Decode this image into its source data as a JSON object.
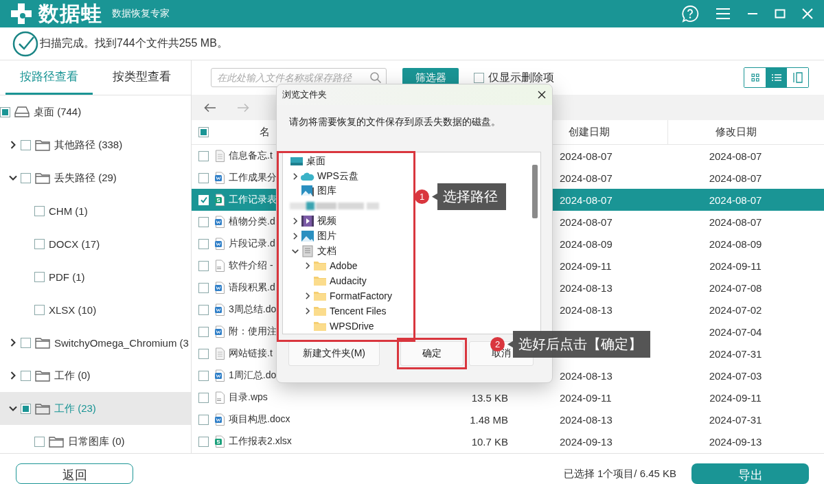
{
  "app": {
    "name": "数据蛙",
    "subtitle": "数据恢复专家"
  },
  "status": {
    "text": "扫描完成。找到744个文件共255 MB。"
  },
  "sidebar": {
    "tabs": [
      {
        "label": "按路径查看",
        "selected": true
      },
      {
        "label": "按类型查看",
        "selected": false
      }
    ],
    "tree": [
      {
        "label": "桌面 (744)",
        "kind": "drive",
        "checked": false,
        "partial": true,
        "selected": false,
        "children": [
          {
            "label": "其他路径 (338)",
            "kind": "folder",
            "checked": false,
            "partial": false,
            "expanded": false,
            "selected": false
          },
          {
            "label": "丢失路径 (29)",
            "kind": "folder",
            "checked": false,
            "partial": false,
            "expanded": true,
            "selected": false,
            "children": [
              {
                "label": "CHM (1)",
                "kind": "type",
                "checked": false,
                "partial": false,
                "selected": false
              },
              {
                "label": "DOCX (17)",
                "kind": "type",
                "checked": false,
                "partial": false,
                "selected": false
              },
              {
                "label": "PDF (1)",
                "kind": "type",
                "checked": false,
                "partial": false,
                "selected": false
              },
              {
                "label": "XLSX (10)",
                "kind": "type",
                "checked": false,
                "partial": false,
                "selected": false
              }
            ]
          },
          {
            "label": "SwitchyOmega_Chromium (3",
            "kind": "folder",
            "checked": false,
            "partial": false,
            "expanded": false,
            "selected": false
          },
          {
            "label": "工作 (0)",
            "kind": "folder",
            "checked": false,
            "partial": false,
            "expanded": false,
            "selected": false
          },
          {
            "label": "工作 (23)",
            "kind": "folder",
            "checked": false,
            "partial": true,
            "expanded": true,
            "selected": true,
            "children": [
              {
                "label": "日常图库 (0)",
                "kind": "folder",
                "checked": false,
                "partial": false,
                "selected": false
              }
            ]
          }
        ]
      }
    ]
  },
  "toolbar": {
    "search_placeholder": "在此处输入文件名称或保存路径",
    "filter": "筛选器",
    "deleted_only": {
      "label": "仅显示删除项",
      "checked": false
    },
    "views": [
      {
        "kind": "grid",
        "selected": false
      },
      {
        "kind": "list",
        "selected": true
      },
      {
        "kind": "columns",
        "selected": false
      }
    ]
  },
  "table": {
    "header": {
      "checked": false,
      "partial": true,
      "name": "名",
      "created": "创建日期",
      "modified": "修改日期"
    },
    "rows": [
      {
        "name": "信息备忘.t",
        "kind": "text",
        "checked": false,
        "selected": false,
        "created": "2024-08-07",
        "modified": "2024-08-07"
      },
      {
        "name": "工作成果分",
        "kind": "word",
        "checked": false,
        "selected": false,
        "created": "2024-08-07",
        "modified": "2024-08-07"
      },
      {
        "name": "工作记录表",
        "kind": "sheet",
        "checked": true,
        "selected": true,
        "created": "2024-08-07",
        "modified": "2024-08-07"
      },
      {
        "name": "植物分类.d",
        "kind": "word",
        "checked": false,
        "selected": false,
        "created": "2024-08-07",
        "modified": "2024-08-07"
      },
      {
        "name": "片段记录.d",
        "kind": "word",
        "checked": false,
        "selected": false,
        "created": "2024-08-09",
        "modified": "2024-08-09"
      },
      {
        "name": "软件介绍 -",
        "kind": "wps",
        "checked": false,
        "selected": false,
        "created": "2024-09-11",
        "modified": "2024-09-11"
      },
      {
        "name": "语段积累.d",
        "kind": "word",
        "checked": false,
        "selected": false,
        "created": "2024-08-13",
        "modified": "2024-07-08"
      },
      {
        "name": "3周总结.do",
        "kind": "word",
        "checked": false,
        "selected": false,
        "created": "2024-08-13",
        "modified": "2024-07-02"
      },
      {
        "name": "附：使用注",
        "kind": "word",
        "checked": false,
        "selected": false,
        "modified": "2024-07-04"
      },
      {
        "name": "网站链接.t",
        "kind": "text",
        "checked": false,
        "selected": false,
        "modified": "2024-07-31"
      },
      {
        "name": "1周汇总.do",
        "kind": "word",
        "checked": false,
        "selected": false,
        "created": "2024-08-13",
        "modified": "2024-07-03"
      },
      {
        "name": "目录.wps",
        "kind": "wps",
        "checked": false,
        "selected": false,
        "size": "13.5 KB",
        "created": "2024-09-11",
        "modified": "2024-09-11"
      },
      {
        "name": "项目构思.docx",
        "kind": "word",
        "checked": false,
        "selected": false,
        "size": "1.48 MB",
        "created": "2024-08-13",
        "modified": "2024-07-31"
      },
      {
        "name": "工作报表2.xlsx",
        "kind": "sheet",
        "checked": false,
        "selected": false,
        "size": "10.7 KB",
        "created": "2024-09-13",
        "modified": "2024-09-13"
      }
    ]
  },
  "dialog": {
    "title": "浏览文件夹",
    "message": "请勿将需要恢复的文件保存到原丢失数据的磁盘。",
    "tree_highlighted": true,
    "tree": [
      {
        "label": "桌面",
        "kind": "desktop",
        "children": [
          {
            "label": "WPS云盘",
            "kind": "cloud",
            "expandable": true,
            "expanded": false
          },
          {
            "label": "图库",
            "kind": "gallery",
            "expandable": false
          },
          {
            "kind": "blurred"
          },
          {
            "label": "视频",
            "kind": "video",
            "expandable": true,
            "expanded": false
          },
          {
            "label": "图片",
            "kind": "picture",
            "expandable": true,
            "expanded": false
          },
          {
            "label": "文档",
            "kind": "document",
            "expandable": true,
            "expanded": true,
            "children": [
              {
                "label": "Adobe",
                "kind": "folder",
                "expandable": true,
                "expanded": false
              },
              {
                "label": "Audacity",
                "kind": "folder",
                "expandable": false
              },
              {
                "label": "FormatFactory",
                "kind": "folder",
                "expandable": true,
                "expanded": false
              },
              {
                "label": "Tencent Files",
                "kind": "folder",
                "expandable": true,
                "expanded": false
              },
              {
                "label": "WPSDrive",
                "kind": "folder",
                "expandable": false
              }
            ]
          }
        ]
      }
    ],
    "buttons": [
      {
        "label": "新建文件夹(M)",
        "highlighted": false
      },
      {
        "label": "确定",
        "highlighted": true
      },
      {
        "label": "取消",
        "highlighted": false
      }
    ]
  },
  "callouts": [
    {
      "number": "1",
      "text": "选择路径"
    },
    {
      "number": "2",
      "text": "选好后点击【确定】"
    }
  ],
  "footer": {
    "back": "返回",
    "selection": "已选择 1个项目/ 6.45 KB",
    "export": "导出"
  }
}
